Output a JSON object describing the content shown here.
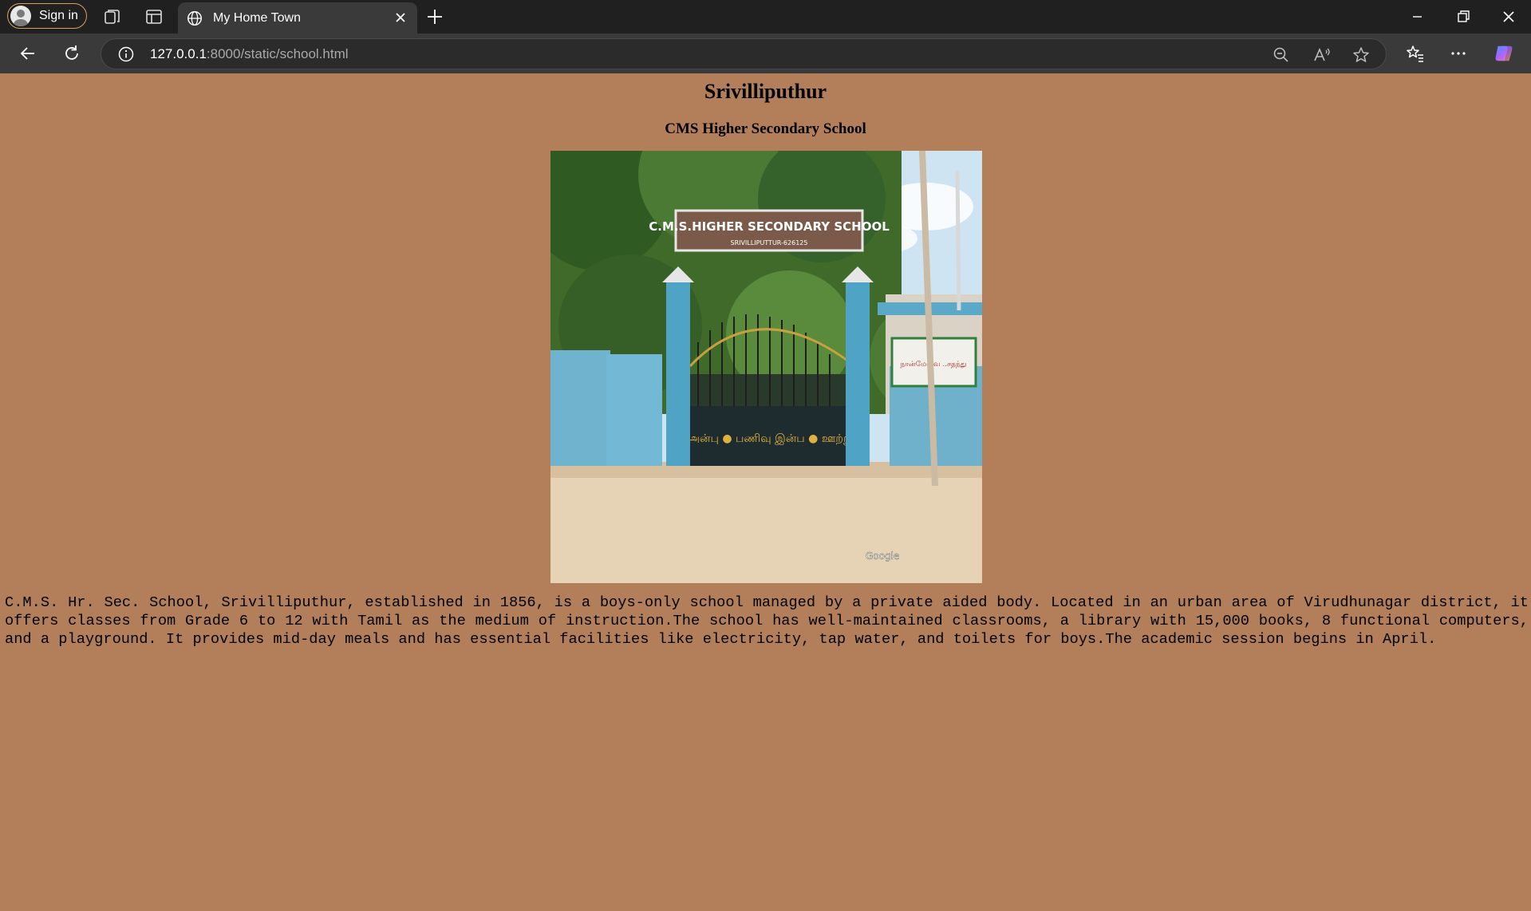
{
  "browser": {
    "sign_in_label": "Sign in",
    "tab_title": "My Home Town",
    "url_host": "127.0.0.1",
    "url_rest": ":8000/static/school.html"
  },
  "page": {
    "background": "#b27f5a",
    "heading": "Srivilliputhur",
    "subheading": "CMS Higher Secondary School",
    "photo": {
      "sign_main": "C.M.S.HIGHER SECONDARY SCHOOL",
      "sign_sub": "SRIVILLIPUTTUR-626125",
      "gate_text": "அன்பு  ●  பணிவு   இன்ப  ●  ஊற்று",
      "wall_board": "நான்மேவை ..சதந்து",
      "watermark": "Google"
    },
    "description": "C.M.S. Hr. Sec. School, Srivilliputhur, established in 1856, is a boys-only school managed by a private aided body. Located in an urban area of Virudhunagar district, it offers classes from Grade 6 to 12 with Tamil as the medium of instruction.The school has well-maintained classrooms, a library with 15,000 books, 8 functional computers, and a playground. It provides mid-day meals and has essential facilities like electricity, tap water, and toilets for boys.The academic session begins in April."
  }
}
